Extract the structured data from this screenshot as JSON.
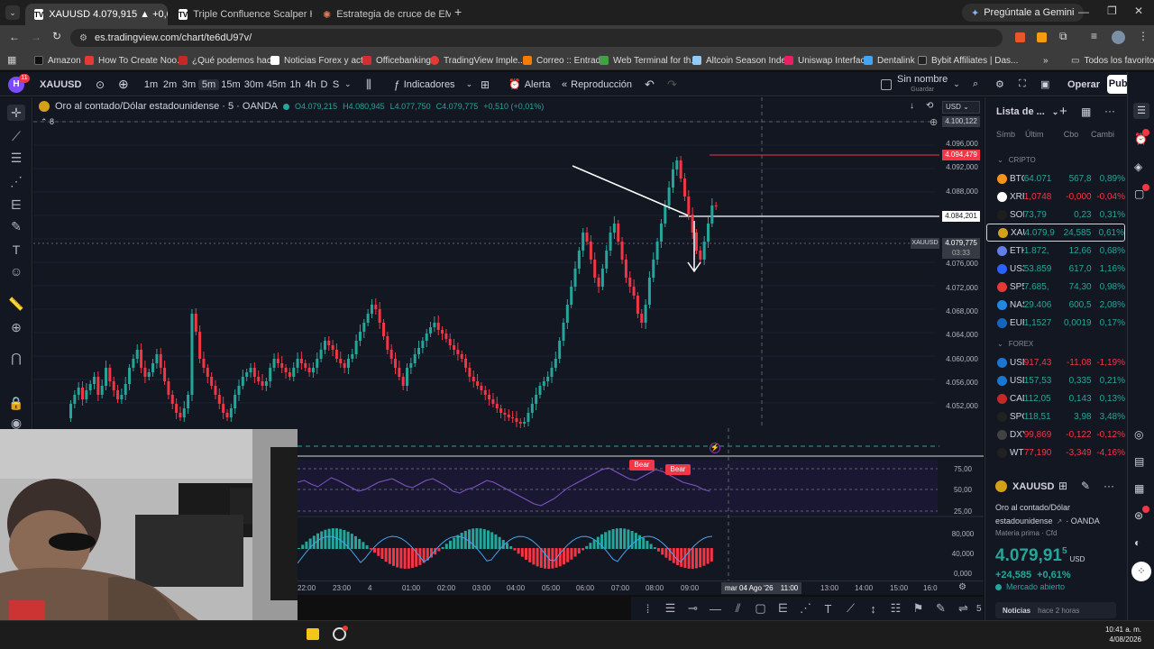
{
  "browser": {
    "tabs": [
      {
        "title": "XAUUSD 4.079,915 ▲ +0,61% S",
        "active": true
      },
      {
        "title": "Triple Confluence Scalper HMA",
        "active": false
      },
      {
        "title": "Estrategia de cruce de EMAs co",
        "active": false
      }
    ],
    "gemini": "Pregúntale a Gemini",
    "url": "es.tradingview.com/chart/te6dU97v/",
    "bookmarks": [
      "Amazon",
      "How To Create Noo...",
      "¿Qué podemos hac...",
      "Noticias Forex y act...",
      "Officebanking",
      "TradingView Imple...",
      "Correo :: Entrada",
      "Web Terminal for th...",
      "Altcoin Season Inde...",
      "Uniswap Interface",
      "Dentalink",
      "Bybit Affiliates | Das..."
    ],
    "bookmarks_folder": "Todos los favoritos"
  },
  "header": {
    "avatar_letter": "H",
    "avatar_badge": "11",
    "symbol": "XAUUSD",
    "intervals": [
      "1m",
      "2m",
      "3m",
      "5m",
      "15m",
      "30m",
      "45m",
      "1h",
      "4h",
      "D",
      "S"
    ],
    "active_interval": "5m",
    "indicators": "Indicadores",
    "alert": "Alerta",
    "replay": "Reproducción",
    "layout_name": "Sin nombre",
    "layout_sub": "Guardar",
    "trade": "Operar",
    "publish": "Publicar"
  },
  "chart": {
    "legend_title": "Oro al contado/Dólar estadounidense · 5 · OANDA",
    "ohlc": {
      "o": "O4.079,215",
      "h": "H4.080,945",
      "l": "L4.077,750",
      "c": "C4.079,775",
      "chg": "+0,510 (+0,01%)"
    },
    "legend_count": "8",
    "currency": "USD",
    "price_axis": [
      "4.096,000",
      "4.092,000",
      "4.088,000",
      "4.076,000",
      "4.072,000",
      "4.068,000",
      "4.064,000",
      "4.060,000",
      "4.056,000",
      "4.052,000",
      "4.048,000"
    ],
    "crosshair_price": "4.100,122",
    "red_line_price": "4.094,479",
    "white_line_price": "4.084,201",
    "last_price": "4.079,775",
    "last_symbol": "XAUUSD",
    "countdown": "03:33",
    "rsi_axis": [
      "75,00",
      "50,00",
      "25,00"
    ],
    "rsi_labels": [
      "Bear",
      "Bear"
    ],
    "osc_axis": [
      "80,000",
      "40,000",
      "0,000"
    ],
    "time_axis": [
      "22:00",
      "23:00",
      "4",
      "01:00",
      "02:00",
      "03:00",
      "04:00",
      "05:00",
      "06:00",
      "07:00",
      "08:00",
      "09:00",
      "13:00",
      "14:00",
      "15:00",
      "16:0"
    ],
    "time_cursor": "mar 04 Ago '26",
    "time_cursor2": "11:00"
  },
  "watchlist": {
    "title": "Lista de ...",
    "cols": [
      "Símb",
      "Últim",
      "Cbo",
      "Cambi"
    ],
    "sections": [
      "CRIPTO",
      "FOREX"
    ],
    "crypto": [
      {
        "sym": "BTC",
        "last": "64.071",
        "chg": "567,8",
        "pct": "0,89%",
        "pos": true,
        "color": "#f7931a"
      },
      {
        "sym": "XRP",
        "last": "1,0748",
        "chg": "-0,000",
        "pct": "-0,04%",
        "pos": false,
        "color": "#ffffff"
      },
      {
        "sym": "SOL",
        "last": "73,79",
        "chg": "0,23",
        "pct": "0,31%",
        "pos": true,
        "color": "#1e1e1e"
      },
      {
        "sym": "XAU",
        "last": "4.079,9",
        "chg": "24,585",
        "pct": "0,61%",
        "pos": true,
        "color": "#d4a017"
      },
      {
        "sym": "ETH",
        "last": "1.872,",
        "chg": "12,66",
        "pct": "0,68%",
        "pos": true,
        "color": "#627eea"
      },
      {
        "sym": "US3",
        "last": "53.859",
        "chg": "617,0",
        "pct": "1,16%",
        "pos": true,
        "color": "#2962ff"
      },
      {
        "sym": "SP5",
        "last": "7.685,",
        "chg": "74,30",
        "pct": "0,98%",
        "pos": true,
        "color": "#e53935"
      },
      {
        "sym": "NAS",
        "last": "29.406",
        "chg": "600,5",
        "pct": "2,08%",
        "pos": true,
        "color": "#1e88e5"
      },
      {
        "sym": "EUR",
        "last": "1,1527",
        "chg": "0,0019",
        "pct": "0,17%",
        "pos": true,
        "color": "#1565c0"
      }
    ],
    "forex": [
      {
        "sym": "USD",
        "last": "917,43",
        "chg": "-11,08",
        "pct": "-1,19%",
        "pos": false,
        "color": "#1976d2"
      },
      {
        "sym": "USD",
        "last": "157,53",
        "chg": "0,335",
        "pct": "0,21%",
        "pos": true,
        "color": "#1976d2"
      },
      {
        "sym": "CAD",
        "last": "112,05",
        "chg": "0,143",
        "pct": "0,13%",
        "pos": true,
        "color": "#c62828"
      },
      {
        "sym": "SPC",
        "last": "118,51",
        "chg": "3,98",
        "pct": "3,48%",
        "pos": true,
        "color": "#212121"
      },
      {
        "sym": "DXY",
        "last": "99,869",
        "chg": "-0,122",
        "pct": "-0,12%",
        "pos": false,
        "color": "#424242"
      },
      {
        "sym": "WTI",
        "last": "77,190",
        "chg": "-3,349",
        "pct": "-4,16%",
        "pos": false,
        "color": "#212121"
      }
    ]
  },
  "details": {
    "sym": "XAUUSD",
    "name1": "Oro al contado/Dólar",
    "name2": "estadounidense",
    "broker": "· OANDA",
    "type": "Materia prima · Cfd",
    "price": "4.079,91",
    "price_sup": "5",
    "currency": "USD",
    "change": "+24,585",
    "change_pct": "+0,61%",
    "status": "Mercado abierto",
    "news": "Noticias",
    "news_time": "hace 2 horas"
  },
  "taskbar": {
    "time": "10:41 a. m.",
    "date": "4/08/2026"
  },
  "bottom_tools_count": "5",
  "colors": {
    "up": "#26a69a",
    "down": "#f23645",
    "bg": "#131722",
    "accent": "#2962ff"
  }
}
